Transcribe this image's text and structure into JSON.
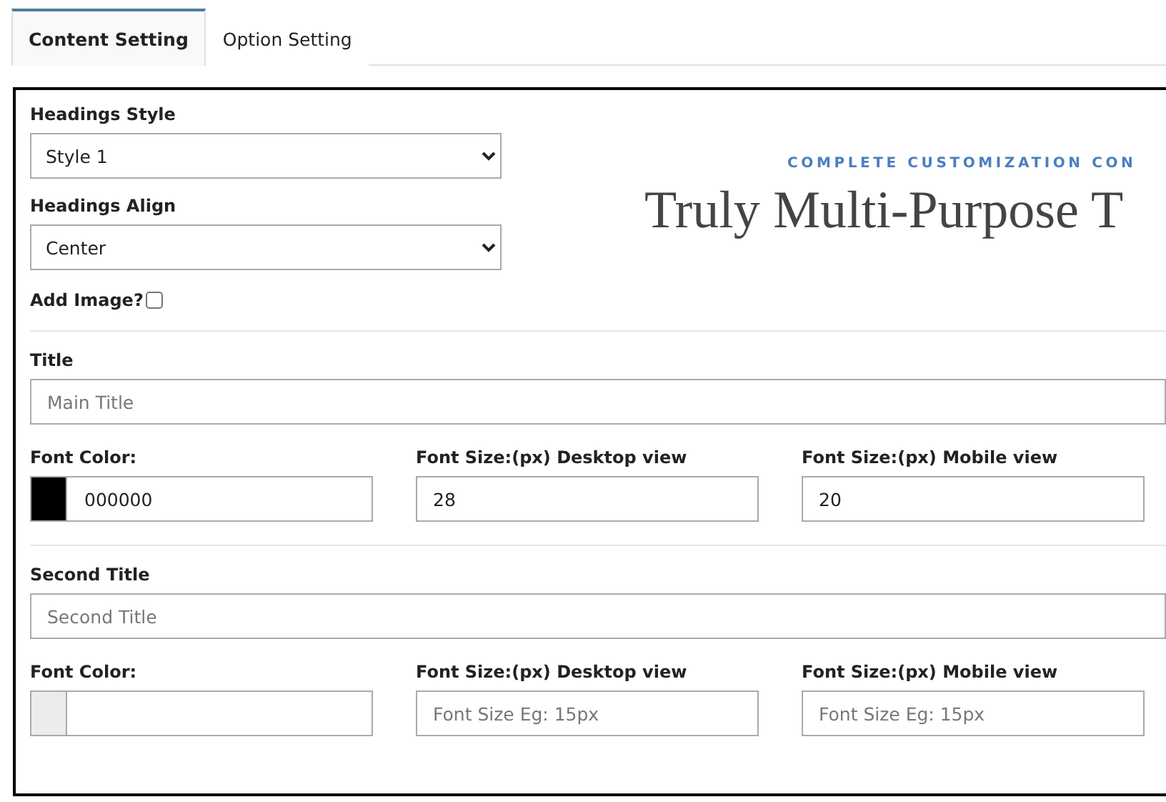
{
  "tabs": [
    {
      "label": "Content Setting",
      "selected": true
    },
    {
      "label": "Option Setting",
      "selected": false
    }
  ],
  "headings_style": {
    "label": "Headings Style",
    "value": "Style 1"
  },
  "headings_align": {
    "label": "Headings Align",
    "value": "Center"
  },
  "add_image": {
    "label": "Add Image?",
    "checked": false
  },
  "preview": {
    "subtitle": "COMPLETE CUSTOMIZATION CON",
    "heading": "Truly Multi-Purpose T"
  },
  "sections": [
    {
      "label": "Title",
      "input": {
        "placeholder": "Main Title"
      },
      "fields": [
        {
          "kind": "color",
          "label": "Font Color:",
          "value": "000000",
          "color": "#000000"
        },
        {
          "kind": "text",
          "label": "Font Size:(px) Desktop view",
          "value": "28"
        },
        {
          "kind": "text",
          "label": "Font Size:(px) Mobile view",
          "value": "20"
        }
      ]
    },
    {
      "label": "Second Title",
      "input": {
        "placeholder": "Second Title"
      },
      "fields": [
        {
          "kind": "color",
          "label": "Font Color:",
          "color": "#ececec"
        },
        {
          "kind": "text",
          "label": "Font Size:(px) Desktop view",
          "placeholder": "Font Size Eg: 15px"
        },
        {
          "kind": "text",
          "label": "Font Size:(px) Mobile view",
          "placeholder": "Font Size Eg: 15px"
        }
      ]
    }
  ]
}
